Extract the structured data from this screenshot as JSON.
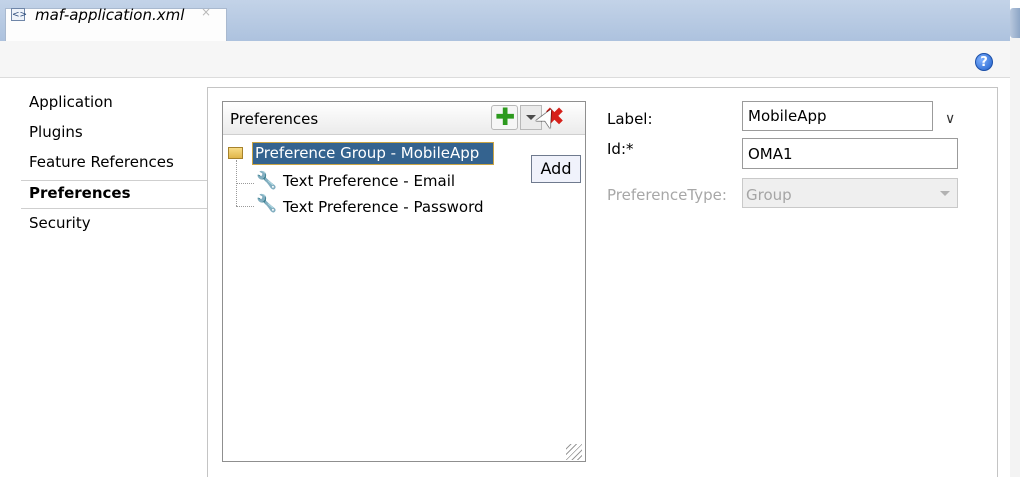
{
  "tab": {
    "title": "maf-application.xml",
    "close": "×",
    "icon": "xml-file-icon"
  },
  "help": {
    "label": "?",
    "icon": "help-icon"
  },
  "nav": {
    "items": [
      {
        "label": "Application",
        "selected": false
      },
      {
        "label": "Plugins",
        "selected": false
      },
      {
        "label": "Feature References",
        "selected": false
      },
      {
        "label": "Preferences",
        "selected": true
      },
      {
        "label": "Security",
        "selected": false
      }
    ]
  },
  "preferences": {
    "title": "Preferences",
    "toolbar": {
      "add_icon": "plus-icon",
      "dropdown_icon": "chevron-down-icon",
      "delete_icon": "delete-x-icon"
    },
    "tree": [
      {
        "label": "Preference Group - MobileApp",
        "icon": "folder-icon",
        "selected": true
      },
      {
        "label": "Text Preference - Email",
        "icon": "wrench-icon"
      },
      {
        "label": "Text Preference - Password",
        "icon": "wrench-icon"
      }
    ],
    "tooltip": "Add"
  },
  "form": {
    "label_label": "Label:",
    "label_value": "MobileApp",
    "id_label": "Id:*",
    "id_value": "OMA1",
    "type_label": "PreferenceType:",
    "type_value": "Group"
  },
  "colors": {
    "accent": "#34638f",
    "tab_bar": "#adc2de",
    "add_green": "#2d9a1e",
    "delete_red": "#d6201a"
  }
}
